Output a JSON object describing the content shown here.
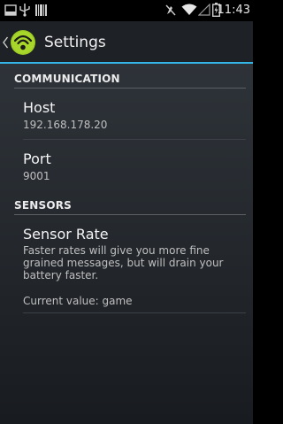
{
  "status_bar": {
    "time": "11:43",
    "icons": [
      "screenshot-icon",
      "usb-icon",
      "barcode-icon",
      "mute-icon",
      "wifi-icon",
      "signal-icon",
      "battery-icon"
    ]
  },
  "action_bar": {
    "title": "Settings",
    "accent_color": "#33b5e5"
  },
  "categories": {
    "communication": "COMMUNICATION",
    "sensors": "SENSORS"
  },
  "preferences": {
    "host": {
      "title": "Host",
      "summary": "192.168.178.20"
    },
    "port": {
      "title": "Port",
      "summary": "9001"
    },
    "sensor_rate": {
      "title": "Sensor Rate",
      "summary": "Faster rates will give you more fine grained messages, but will drain your battery faster.",
      "current": "Current value: game"
    }
  }
}
